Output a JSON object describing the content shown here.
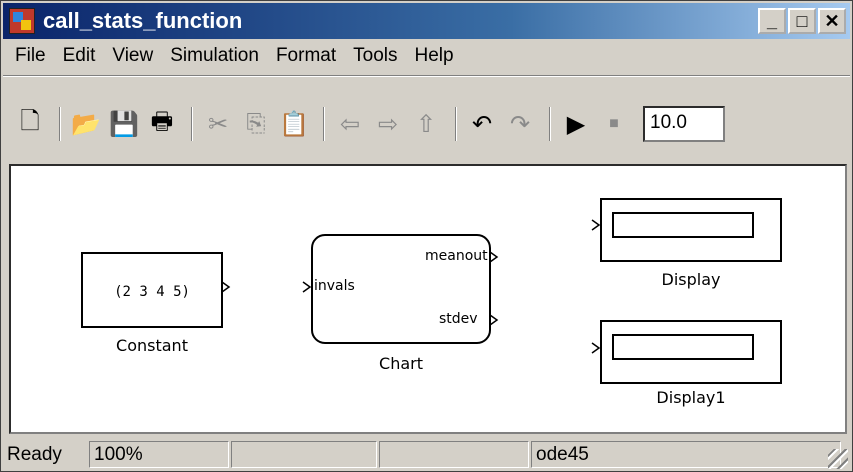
{
  "window": {
    "title": "call_stats_function",
    "minimize_label": "_",
    "maximize_label": "□",
    "close_label": "✕"
  },
  "menu": [
    "File",
    "Edit",
    "View",
    "Simulation",
    "Format",
    "Tools",
    "Help"
  ],
  "toolbar": {
    "new_glyph": "🗋",
    "open_glyph": "📂",
    "save_glyph": "💾",
    "print_glyph": "🖶",
    "cut_glyph": "✂",
    "copy_glyph": "⎘",
    "paste_glyph": "📋",
    "back_glyph": "⇦",
    "forward_glyph": "⇨",
    "up_glyph": "⇧",
    "undo_glyph": "↶",
    "redo_glyph": "↷",
    "start_glyph": "▶",
    "stop_glyph": "■",
    "stop_time": "10.0"
  },
  "model": {
    "constant": {
      "value": "(2  3  4  5)",
      "label": "Constant"
    },
    "chart": {
      "label": "Chart",
      "input_port": "invals",
      "output_port_1": "meanout",
      "output_port_2": "stdev"
    },
    "display1": {
      "label": "Display"
    },
    "display2": {
      "label": "Display1"
    }
  },
  "status": {
    "ready": "Ready",
    "zoom": "100%",
    "cell3": "",
    "cell4": "",
    "solver": "ode45"
  },
  "colors": {
    "titlebar_start": "#0a246a",
    "titlebar_end": "#a6caf0",
    "chrome": "#d4d0c8"
  }
}
